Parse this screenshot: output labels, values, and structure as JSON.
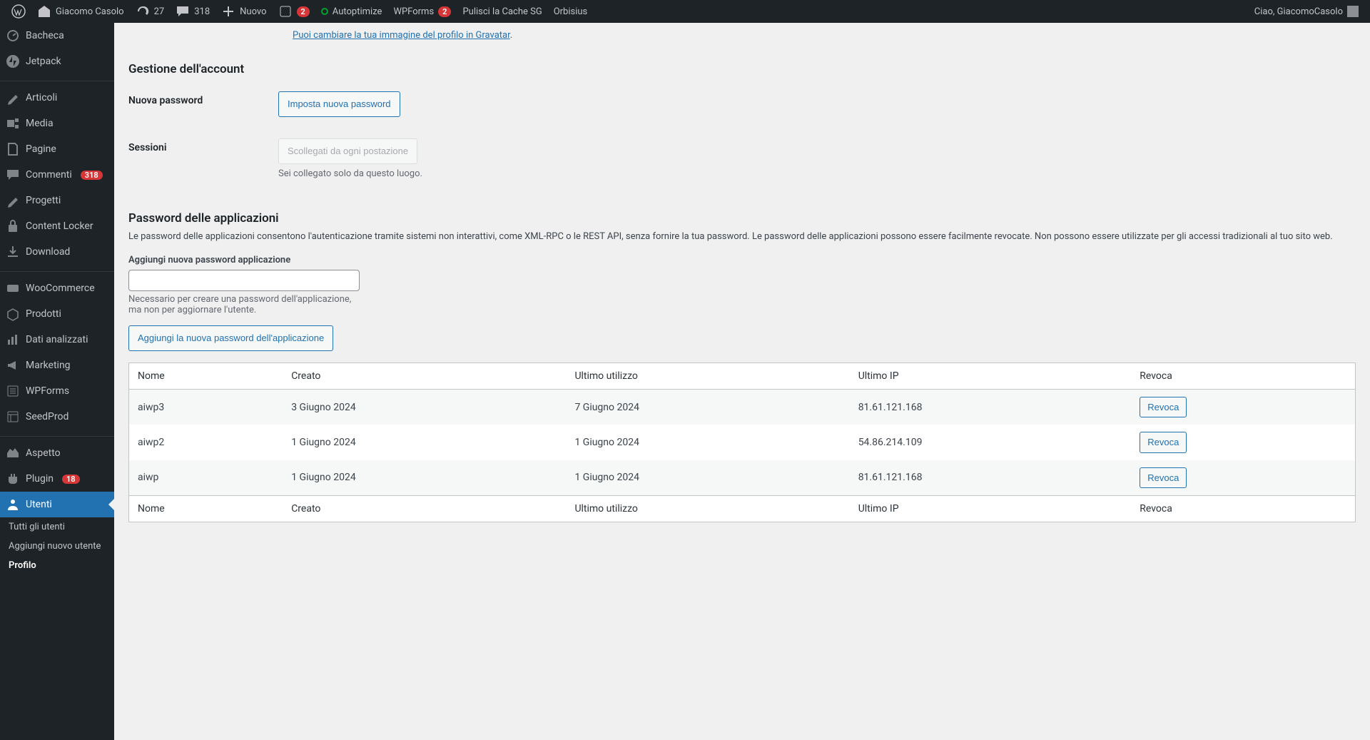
{
  "adminbar": {
    "site_name": "Giacomo Casolo",
    "refresh_count": "27",
    "comments_count": "318",
    "new_label": "Nuovo",
    "forms_badge": "2",
    "autoptimize": "Autoptimize",
    "wpforms": "WPForms",
    "wpforms_badge": "2",
    "cache": "Pulisci la Cache SG",
    "orbisius": "Orbisius",
    "greeting": "Ciao, GiacomoCasolo"
  },
  "sidebar": {
    "items": [
      {
        "label": "Bacheca"
      },
      {
        "label": "Jetpack"
      },
      {
        "label": "Articoli"
      },
      {
        "label": "Media"
      },
      {
        "label": "Pagine"
      },
      {
        "label": "Commenti",
        "badge": "318"
      },
      {
        "label": "Progetti"
      },
      {
        "label": "Content Locker"
      },
      {
        "label": "Download"
      },
      {
        "label": "WooCommerce"
      },
      {
        "label": "Prodotti"
      },
      {
        "label": "Dati analizzati"
      },
      {
        "label": "Marketing"
      },
      {
        "label": "WPForms"
      },
      {
        "label": "SeedProd"
      },
      {
        "label": "Aspetto"
      },
      {
        "label": "Plugin",
        "badge": "18"
      },
      {
        "label": "Utenti"
      }
    ],
    "submenu": [
      {
        "label": "Tutti gli utenti"
      },
      {
        "label": "Aggiungi nuovo utente"
      },
      {
        "label": "Profilo"
      }
    ]
  },
  "content": {
    "gravatar_link": "Puoi cambiare la tua immagine del profilo in Gravatar",
    "gravatar_dot": ".",
    "h2_account": "Gestione dell'account",
    "new_password_label": "Nuova password",
    "new_password_button": "Imposta nuova password",
    "sessions_label": "Sessioni",
    "sessions_button": "Scollegati da ogni postazione",
    "sessions_desc": "Sei collegato solo da questo luogo.",
    "h2_app": "Password delle applicazioni",
    "app_desc": "Le password delle applicazioni consentono l'autenticazione tramite sistemi non interattivi, come XML-RPC o le REST API, senza fornire la tua password. Le password delle applicazioni possono essere facilmente revocate. Non possono essere utilizzate per gli accessi tradizionali al tuo sito web.",
    "new_app_label": "Aggiungi nuova password applicazione",
    "new_app_help": "Necessario per creare una password dell'applicazione, ma non per aggiornare l'utente.",
    "add_app_button": "Aggiungi la nuova password dell'applicazione",
    "cols": {
      "name": "Nome",
      "created": "Creato",
      "last_used": "Ultimo utilizzo",
      "last_ip": "Ultimo IP",
      "revoke": "Revoca"
    },
    "revoke_btn": "Revoca",
    "rows": [
      {
        "name": "aiwp3",
        "created": "3 Giugno 2024",
        "last_used": "7 Giugno 2024",
        "last_ip": "81.61.121.168"
      },
      {
        "name": "aiwp2",
        "created": "1 Giugno 2024",
        "last_used": "1 Giugno 2024",
        "last_ip": "54.86.214.109"
      },
      {
        "name": "aiwp",
        "created": "1 Giugno 2024",
        "last_used": "1 Giugno 2024",
        "last_ip": "81.61.121.168"
      }
    ]
  }
}
